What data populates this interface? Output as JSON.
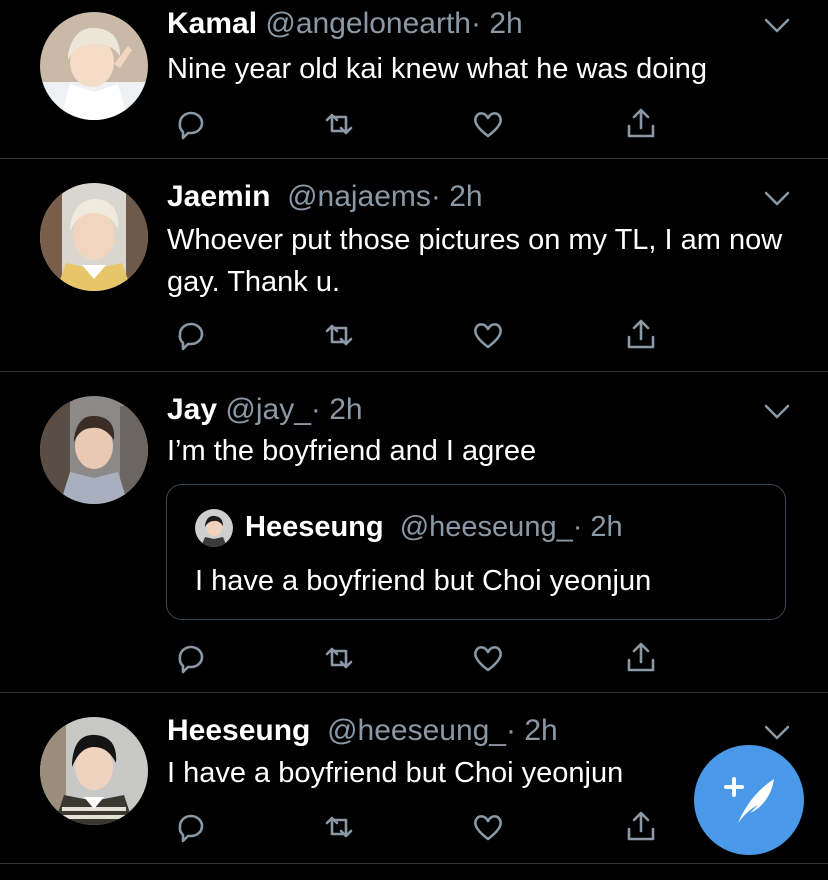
{
  "tweets": [
    {
      "name": "Kamal",
      "handle": "@angelonearth",
      "time": "· 2h",
      "text": "Nine year old kai knew what he was doing"
    },
    {
      "name": "Jaemin",
      "handle": "@najaems",
      "time": "· 2h",
      "text": "Whoever put those pictures on my TL, I am now gay. Thank u."
    },
    {
      "name": "Jay",
      "handle": "@jay_",
      "time": "· 2h",
      "text": "I’m the boyfriend and I agree",
      "quote": {
        "name": "Heeseung",
        "handle": "@heeseung_",
        "time": "· 2h",
        "text": "I have a boyfriend but Choi yeonjun"
      }
    },
    {
      "name": "Heeseung",
      "handle": "@heeseung_",
      "time": "· 2h",
      "text": "I have a boyfriend but Choi yeonjun"
    }
  ],
  "icons": {
    "reply": "reply-icon",
    "retweet": "retweet-icon",
    "like": "like-icon",
    "share": "share-icon",
    "more": "chevron-down-icon",
    "compose": "compose-tweet-icon"
  },
  "colors": {
    "background": "#000000",
    "secondary_text": "#8b98a5",
    "divider": "#2f3336",
    "accent": "#4a99e9"
  }
}
